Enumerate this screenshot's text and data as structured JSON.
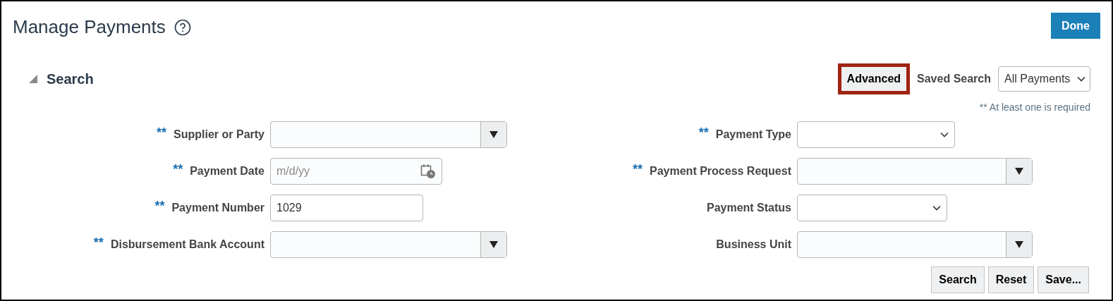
{
  "title": "Manage Payments",
  "done_button": "Done",
  "search": {
    "title": "Search",
    "expanded": true,
    "advanced_button": "Advanced",
    "advanced_highlighted": true,
    "saved_search_label": "Saved Search",
    "saved_search_value": "All Payments",
    "required_note": "** At least one is required",
    "required_mark": "**",
    "left_fields": [
      {
        "label": "Supplier or Party",
        "kind": "combo",
        "required": true
      },
      {
        "label": "Payment Date",
        "kind": "date",
        "required": true,
        "placeholder": "m/d/yy"
      },
      {
        "label": "Payment Number",
        "kind": "text",
        "required": true,
        "value": "1029"
      },
      {
        "label": "Disbursement Bank Account",
        "kind": "combo",
        "required": true
      }
    ],
    "right_fields": [
      {
        "label": "Payment Type",
        "kind": "select",
        "required": true
      },
      {
        "label": "Payment Process Request",
        "kind": "combo",
        "required": true
      },
      {
        "label": "Payment Status",
        "kind": "select",
        "required": false
      },
      {
        "label": "Business Unit",
        "kind": "combo",
        "required": false
      }
    ],
    "buttons": [
      "Search",
      "Reset",
      "Save..."
    ]
  }
}
